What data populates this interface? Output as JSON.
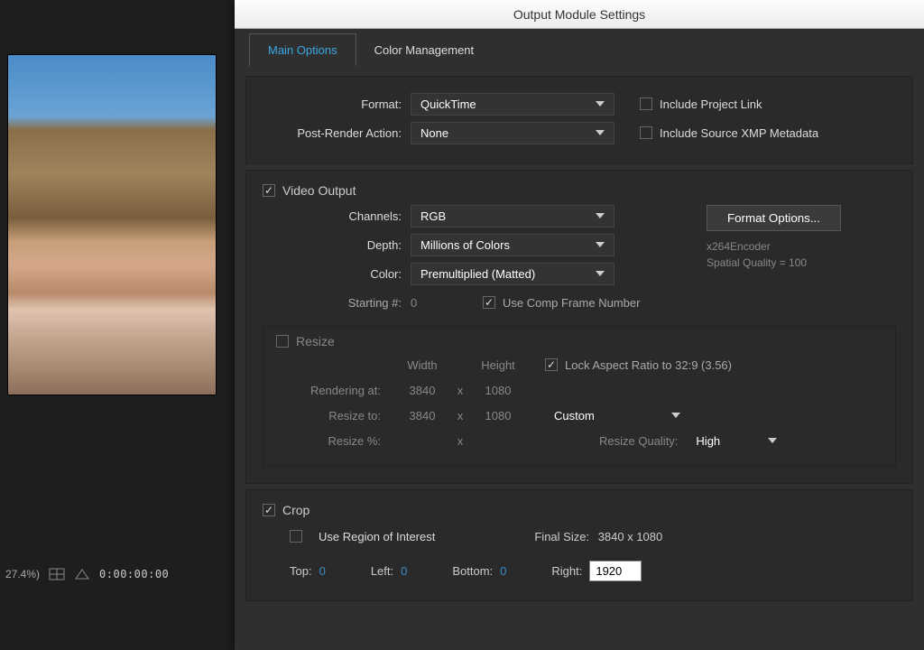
{
  "dialog_title": "Output Module Settings",
  "tabs": {
    "main": "Main Options",
    "color": "Color Management"
  },
  "top": {
    "format_label": "Format:",
    "format_value": "QuickTime",
    "postrender_label": "Post-Render Action:",
    "postrender_value": "None",
    "include_project_link": "Include Project Link",
    "include_xmp": "Include Source XMP Metadata"
  },
  "video": {
    "header": "Video Output",
    "channels_label": "Channels:",
    "channels_value": "RGB",
    "depth_label": "Depth:",
    "depth_value": "Millions of Colors",
    "color_label": "Color:",
    "color_value": "Premultiplied (Matted)",
    "starting_label": "Starting #:",
    "starting_value": "0",
    "use_comp_frame": "Use Comp Frame Number",
    "format_options_btn": "Format Options...",
    "encoder_line1": "x264Encoder",
    "encoder_line2": "Spatial Quality = 100"
  },
  "resize": {
    "header": "Resize",
    "width_h": "Width",
    "height_h": "Height",
    "lock_aspect": "Lock Aspect Ratio to 32:9 (3.56)",
    "rendering_label": "Rendering at:",
    "rendering_w": "3840",
    "rendering_h": "1080",
    "resizeto_label": "Resize to:",
    "resizeto_w": "3840",
    "resizeto_h": "1080",
    "resizeto_preset": "Custom",
    "resizepct_label": "Resize %:",
    "quality_label": "Resize Quality:",
    "quality_value": "High"
  },
  "crop": {
    "header": "Crop",
    "use_roi": "Use Region of Interest",
    "final_size_label": "Final Size:",
    "final_size_value": "3840 x 1080",
    "top_l": "Top:",
    "top_v": "0",
    "left_l": "Left:",
    "left_v": "0",
    "bottom_l": "Bottom:",
    "bottom_v": "0",
    "right_l": "Right:",
    "right_v": "1920"
  },
  "viewer": {
    "zoom": "27.4%)",
    "timecode": "0:00:00:00"
  }
}
